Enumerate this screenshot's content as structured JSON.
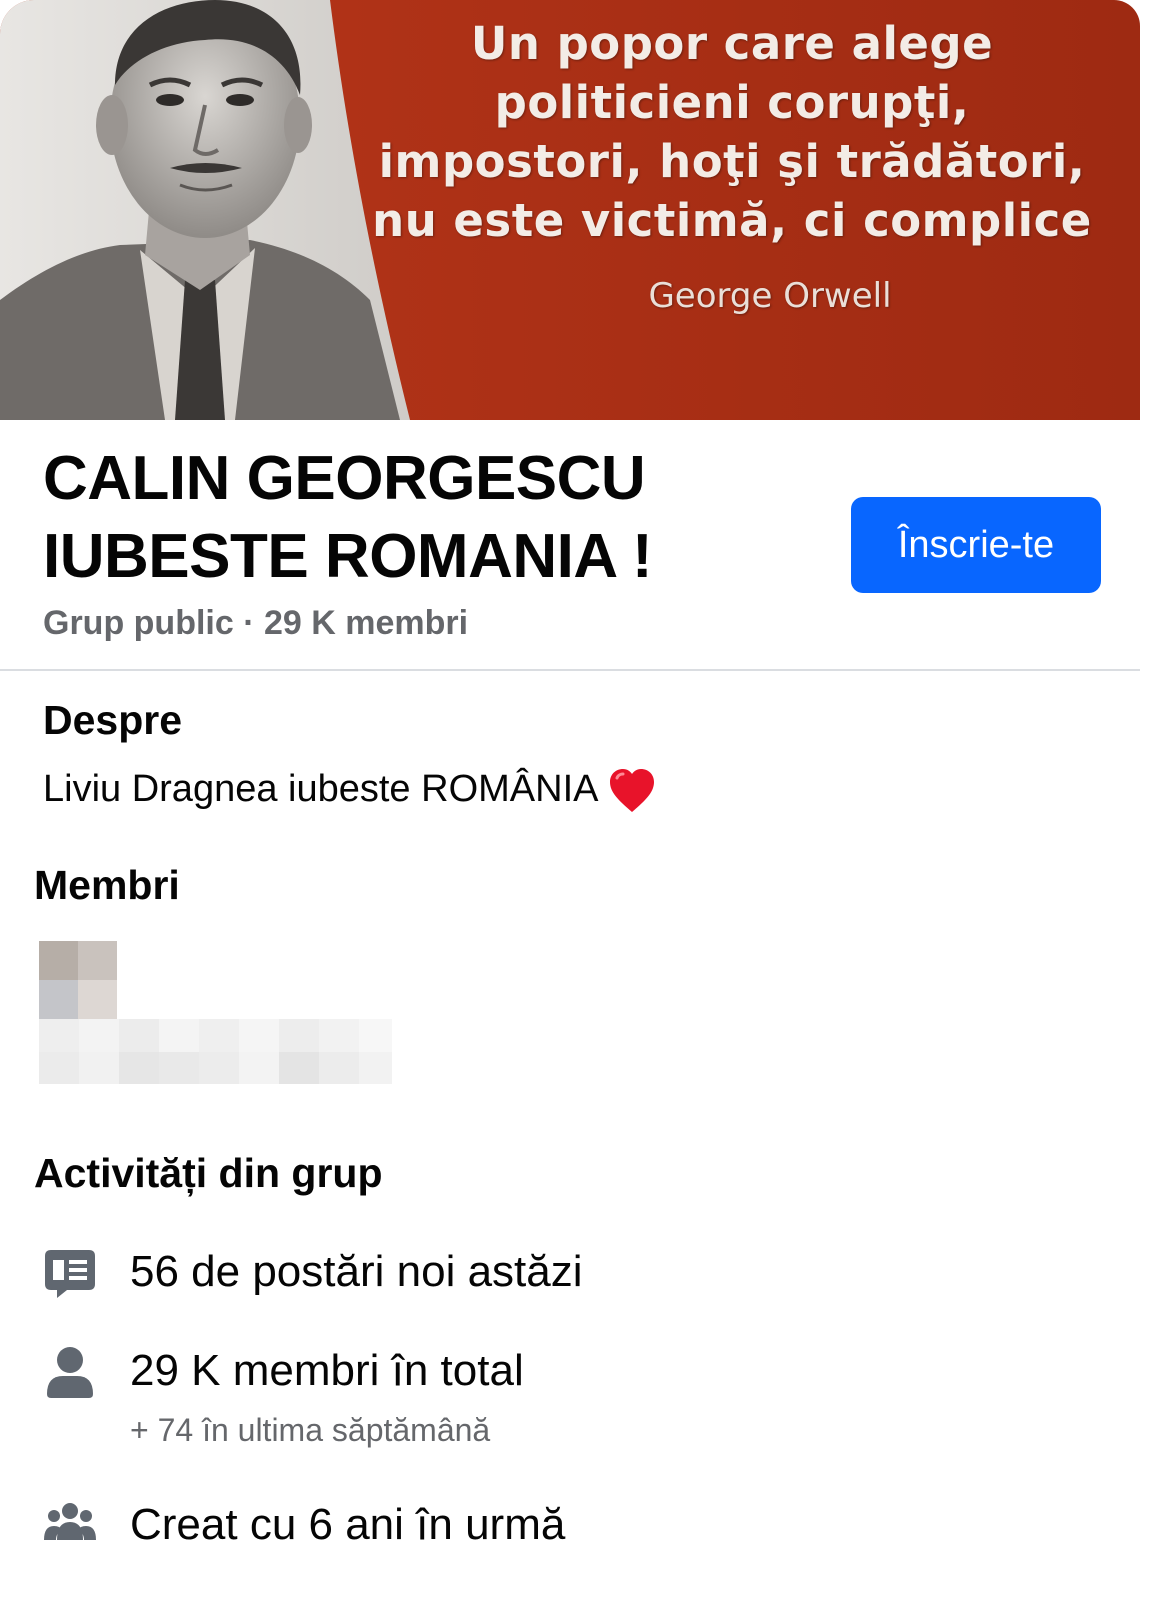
{
  "cover": {
    "quote_lines": [
      "Un popor care alege",
      "politicieni corupţi,",
      "impostori, hoţi şi trădători,",
      "nu este victimă, ci complice"
    ],
    "author": "George Orwell"
  },
  "group": {
    "title_lines": [
      "CALIN GEORGESCU",
      "IUBESTE ROMANIA !"
    ],
    "join_label": "Înscrie-te",
    "meta": "Grup public · 29 K membri"
  },
  "about": {
    "heading": "Despre",
    "text": "Liviu Dragnea iubeste ROMÂNIA"
  },
  "members": {
    "heading": "Membri"
  },
  "activity": {
    "heading": "Activități din grup",
    "items": [
      {
        "icon": "posts-icon",
        "text": "56 de postări noi astăzi"
      },
      {
        "icon": "person-icon",
        "text": "29 K membri în total",
        "subtext": "+ 74 în ultima săptămână"
      },
      {
        "icon": "group-icon",
        "text": "Creat cu 6 ani în urmă"
      }
    ]
  },
  "colors": {
    "accent": "#0866ff",
    "cover_red": "#a92f15",
    "secondary_text": "#65676b"
  }
}
